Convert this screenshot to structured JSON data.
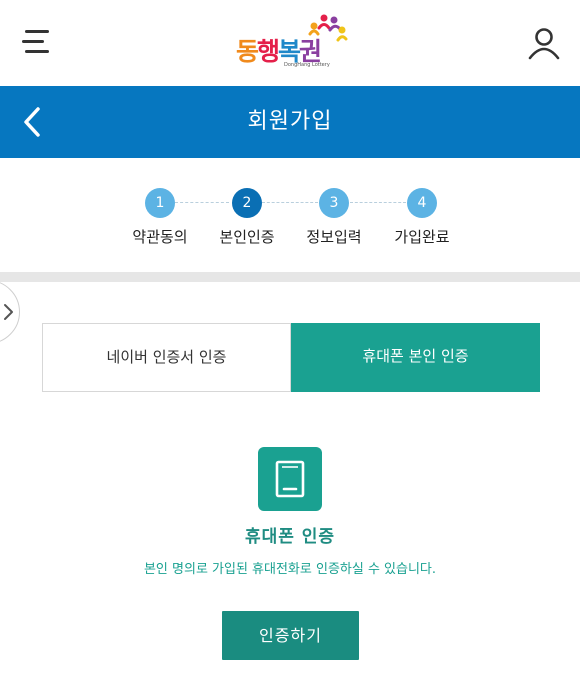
{
  "header": {
    "logo": {
      "text_parts": [
        "동",
        "행",
        "복",
        "권"
      ],
      "subtitle": "DongHang Lottery"
    },
    "menu_icon": "hamburger-menu-icon",
    "user_icon": "user-icon"
  },
  "titlebar": {
    "title": "회원가입",
    "back_icon": "chevron-left-icon",
    "color": "#0677c0"
  },
  "steps": [
    {
      "number": "1",
      "label": "약관동의",
      "active": false
    },
    {
      "number": "2",
      "label": "본인인증",
      "active": true
    },
    {
      "number": "3",
      "label": "정보입력",
      "active": false
    },
    {
      "number": "4",
      "label": "가입완료",
      "active": false
    }
  ],
  "auth_tabs": [
    {
      "label": "네이버 인증서 인증",
      "selected": false
    },
    {
      "label": "휴대폰 본인 인증",
      "selected": true
    }
  ],
  "phone_auth": {
    "icon": "mobile-phone-icon",
    "title": "휴대폰 인증",
    "description": "본인 명의로 가입된 휴대전화로 인증하실 수 있습니다.",
    "button_label": "인증하기"
  },
  "colors": {
    "primary_blue": "#0677c0",
    "step_light": "#5cb3e4",
    "step_active": "#0a6fb4",
    "teal": "#1aa191",
    "teal_dark": "#1a8c80"
  }
}
